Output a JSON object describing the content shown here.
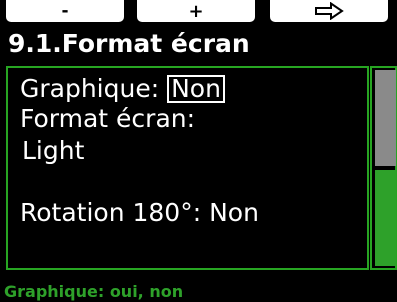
{
  "softkeys": {
    "left_label": "-",
    "middle_label": "+",
    "right_icon": "arrow-right-outline-icon"
  },
  "screen": {
    "title": "9.1.Format écran"
  },
  "settings": {
    "graphique_label": "Graphique:",
    "graphique_value": "Non",
    "format_label": "Format écran:",
    "format_value": "Light",
    "rotation_label": "Rotation 180°:",
    "rotation_value": "Non"
  },
  "hint": "Graphique: oui, non",
  "scrollbar": {
    "thumb_position_fraction": 0.5
  },
  "colors": {
    "background": "#000000",
    "accent_green": "#2ea12a",
    "scroll_thumb": "#8a8a8a",
    "text": "#ffffff"
  }
}
